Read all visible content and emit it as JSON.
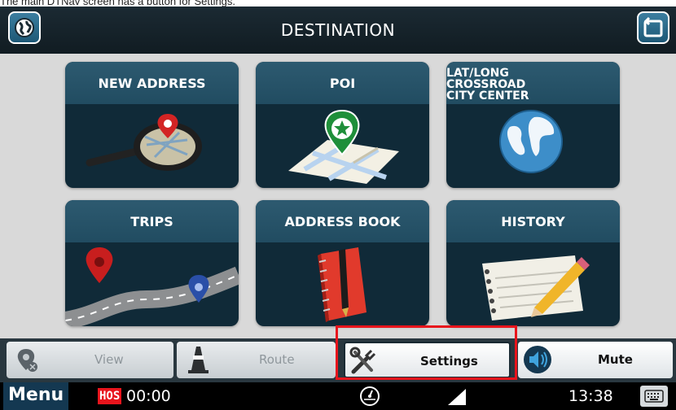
{
  "caption": "The main DTNav screen has a button for Settings.",
  "header": {
    "title": "DESTINATION",
    "left_icon": "globe-icon",
    "right_icon": "back-icon"
  },
  "tiles": [
    {
      "label": "NEW ADDRESS",
      "icon": "magnifier-map-icon"
    },
    {
      "label": "POI",
      "icon": "poi-pin-map-icon"
    },
    {
      "label_lines": [
        "LAT/LONG",
        "CROSSROAD",
        "CITY CENTER"
      ],
      "icon": "earth-globe-icon"
    },
    {
      "label": "TRIPS",
      "icon": "road-pins-icon"
    },
    {
      "label": "ADDRESS BOOK",
      "icon": "notebook-icon"
    },
    {
      "label": "HISTORY",
      "icon": "history-notepad-icon"
    }
  ],
  "toolbar": {
    "view_label": "View",
    "route_label": "Route",
    "settings_label": "Settings",
    "mute_label": "Mute"
  },
  "status": {
    "menu_label": "Menu",
    "hos_badge": "HOS",
    "hos_time": "00:00",
    "clock": "13:38"
  },
  "colors": {
    "highlight": "#e8141c",
    "tile_band": "#2d5a70",
    "tile_body": "#102a38"
  }
}
